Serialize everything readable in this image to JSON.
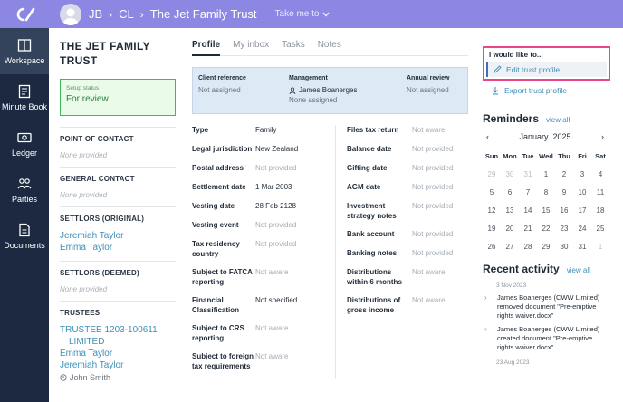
{
  "header": {
    "crumbs": [
      "JB",
      "CL",
      "The Jet Family Trust"
    ],
    "takeme": "Take me to"
  },
  "sidebar": {
    "items": [
      {
        "label": "Workspace",
        "icon": "workspace-icon"
      },
      {
        "label": "Minute Book",
        "icon": "minute-book-icon"
      },
      {
        "label": "Ledger",
        "icon": "ledger-icon"
      },
      {
        "label": "Parties",
        "icon": "parties-icon"
      },
      {
        "label": "Documents",
        "icon": "documents-icon"
      }
    ]
  },
  "left": {
    "trust_name": "THE JET FAMILY TRUST",
    "setup_status_label": "Setup status",
    "setup_status_value": "For review",
    "point_of_contact": "POINT OF CONTACT",
    "point_of_contact_value": "None provided",
    "general_contact": "GENERAL CONTACT",
    "general_contact_value": "None provided",
    "settlors_original": "SETTLORS (ORIGINAL)",
    "settlors_original_people": [
      "Jeremiah Taylor",
      "Emma Taylor"
    ],
    "settlors_deemed": "SETTLORS (DEEMED)",
    "settlors_deemed_value": "None provided",
    "trustees": "TRUSTEES",
    "trustees_people": [
      "TRUSTEE 1203-100611",
      "LIMITED",
      "Emma Taylor",
      "Jeremiah Taylor"
    ],
    "former_trustee": "John Smith"
  },
  "tabs": [
    "Profile",
    "My inbox",
    "Tasks",
    "Notes"
  ],
  "info": {
    "client_ref_label": "Client reference",
    "client_ref_value": "Not assigned",
    "management_label": "Management",
    "management_person": "James Boanerges",
    "management_value": "None assigned",
    "annual_review_label": "Annual review",
    "annual_review_value": "Not assigned"
  },
  "fields_left": [
    {
      "label": "Type",
      "value": "Family",
      "muted": false
    },
    {
      "label": "Legal jurisdiction",
      "value": "New Zealand",
      "muted": false
    },
    {
      "label": "Postal address",
      "value": "Not provided",
      "muted": true
    },
    {
      "label": "Settlement date",
      "value": "1 Mar 2003",
      "muted": false
    },
    {
      "label": "Vesting date",
      "value": "28 Feb 2128",
      "muted": false
    },
    {
      "label": "Vesting event",
      "value": "Not provided",
      "muted": true
    },
    {
      "label": "Tax residency country",
      "value": "Not provided",
      "muted": true
    },
    {
      "label": "Subject to FATCA reporting",
      "value": "Not aware",
      "muted": true
    },
    {
      "label": "Financial Classification",
      "value": "Not specified",
      "muted": false
    },
    {
      "label": "Subject to CRS reporting",
      "value": "Not aware",
      "muted": true
    },
    {
      "label": "Subject to foreign tax requirements",
      "value": "Not aware",
      "muted": true
    }
  ],
  "fields_right": [
    {
      "label": "Files tax return",
      "value": "Not aware"
    },
    {
      "label": "Balance date",
      "value": "Not provided"
    },
    {
      "label": "Gifting date",
      "value": "Not provided"
    },
    {
      "label": "AGM date",
      "value": "Not provided"
    },
    {
      "label": "Investment strategy notes",
      "value": "Not provided"
    },
    {
      "label": "Bank account",
      "value": "Not provided"
    },
    {
      "label": "Banking notes",
      "value": "Not provided"
    },
    {
      "label": "Distributions within 6 months",
      "value": "Not aware"
    },
    {
      "label": "Distributions of gross income",
      "value": "Not aware"
    }
  ],
  "actions": {
    "title": "I would like to...",
    "edit": "Edit trust profile",
    "export": "Export trust profile"
  },
  "reminders": {
    "title": "Reminders",
    "view_all": "view all",
    "month": "January",
    "year": "2025",
    "weekdays": [
      "Sun",
      "Mon",
      "Tue",
      "Wed",
      "Thu",
      "Fri",
      "Sat"
    ],
    "weeks": [
      [
        "29",
        "30",
        "31",
        "1",
        "2",
        "3",
        "4"
      ],
      [
        "5",
        "6",
        "7",
        "8",
        "9",
        "10",
        "11"
      ],
      [
        "12",
        "13",
        "14",
        "15",
        "16",
        "17",
        "18"
      ],
      [
        "19",
        "20",
        "21",
        "22",
        "23",
        "24",
        "25"
      ],
      [
        "26",
        "27",
        "28",
        "29",
        "30",
        "31",
        "1"
      ]
    ]
  },
  "activity": {
    "title": "Recent activity",
    "view_all": "view all",
    "date1": "3 Nov 2023",
    "items": [
      "James Boanerges (CWW Limited) removed document \"Pre-emptive rights waiver.docx\"",
      "James Boanerges (CWW Limited) created document \"Pre-emptive rights waiver.docx\""
    ],
    "date2": "23 Aug 2023"
  }
}
